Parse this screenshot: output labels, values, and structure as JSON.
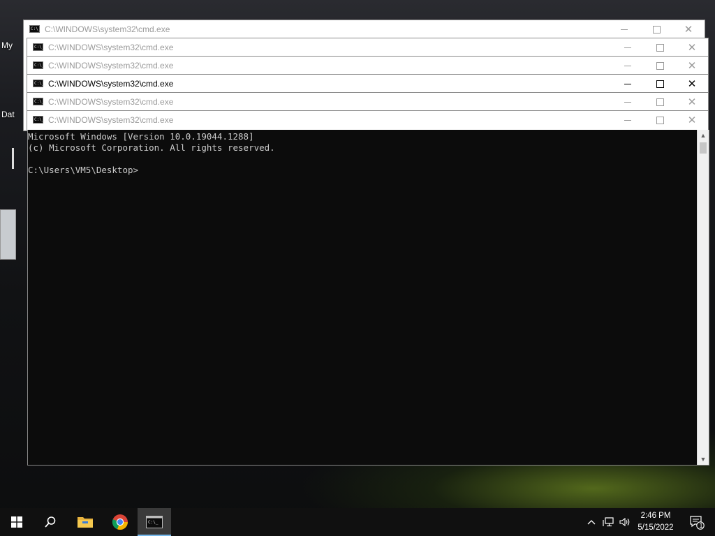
{
  "desktop": {
    "labels": [
      "My",
      "Dat"
    ]
  },
  "windows": [
    {
      "title": "C:\\WINDOWS\\system32\\cmd.exe",
      "active": false
    },
    {
      "title": "C:\\WINDOWS\\system32\\cmd.exe",
      "active": false
    },
    {
      "title": "C:\\WINDOWS\\system32\\cmd.exe",
      "active": false
    },
    {
      "title": "C:\\WINDOWS\\system32\\cmd.exe",
      "active": true
    },
    {
      "title": "C:\\WINDOWS\\system32\\cmd.exe",
      "active": false
    },
    {
      "title": "C:\\WINDOWS\\system32\\cmd.exe",
      "active": false
    }
  ],
  "console": {
    "lines": [
      "Microsoft Windows [Version 10.0.19044.1288]",
      "(c) Microsoft Corporation. All rights reserved.",
      "",
      "C:\\Users\\VM5\\Desktop>"
    ]
  },
  "taskbar": {
    "pinned": [
      "start-icon",
      "search-icon",
      "file-explorer-icon",
      "chrome-icon",
      "cmd-icon"
    ],
    "tray": {
      "time": "2:46 PM",
      "date": "5/15/2022",
      "notification_count": "1"
    }
  },
  "colors": {
    "console_bg": "#0c0c0c",
    "console_fg": "#cccccc",
    "taskbar_bg": "#101010",
    "accent": "#76b9ed"
  }
}
